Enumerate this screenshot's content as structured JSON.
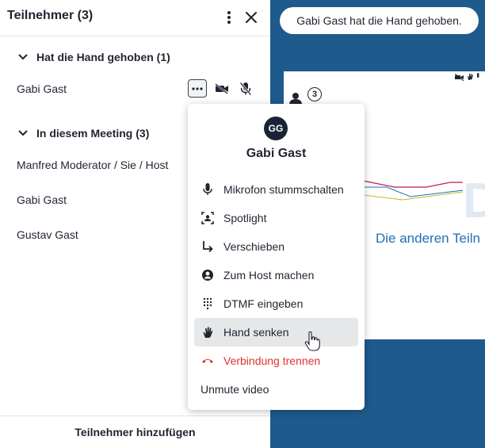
{
  "panel": {
    "title": "Teilnehmer (3)",
    "sections": [
      {
        "label": "Hat die Hand gehoben (1)",
        "participants": [
          "Gabi Gast"
        ]
      },
      {
        "label": "In diesem Meeting (3)",
        "participants": [
          "Manfred Moderator / Sie / Host",
          "Gabi Gast",
          "Gustav Gast"
        ]
      }
    ],
    "footer_button": "Teilnehmer hinzufügen"
  },
  "toast": "Gabi Gast hat die Hand gehoben.",
  "slide": {
    "caption": "Die anderen Teiln",
    "thumb_badge": "3"
  },
  "menu": {
    "avatar_initials": "GG",
    "name": "Gabi Gast",
    "items": [
      {
        "label": "Mikrofon stummschalten",
        "icon": "microphone-icon"
      },
      {
        "label": "Spotlight",
        "icon": "spotlight-icon"
      },
      {
        "label": "Verschieben",
        "icon": "move-arrow-icon"
      },
      {
        "label": "Zum Host machen",
        "icon": "user-circle-icon"
      },
      {
        "label": "DTMF eingeben",
        "icon": "dialpad-icon"
      },
      {
        "label": "Hand senken",
        "icon": "raised-hand-icon"
      },
      {
        "label": "Verbindung trennen",
        "icon": "hang-up-icon"
      },
      {
        "label": "Unmute video",
        "icon": ""
      }
    ]
  },
  "colors": {
    "background_blue": "#1e5a8c",
    "danger_red": "#e0312f",
    "hover_gray": "#e6e7e9",
    "text_dark": "#1f2430"
  }
}
